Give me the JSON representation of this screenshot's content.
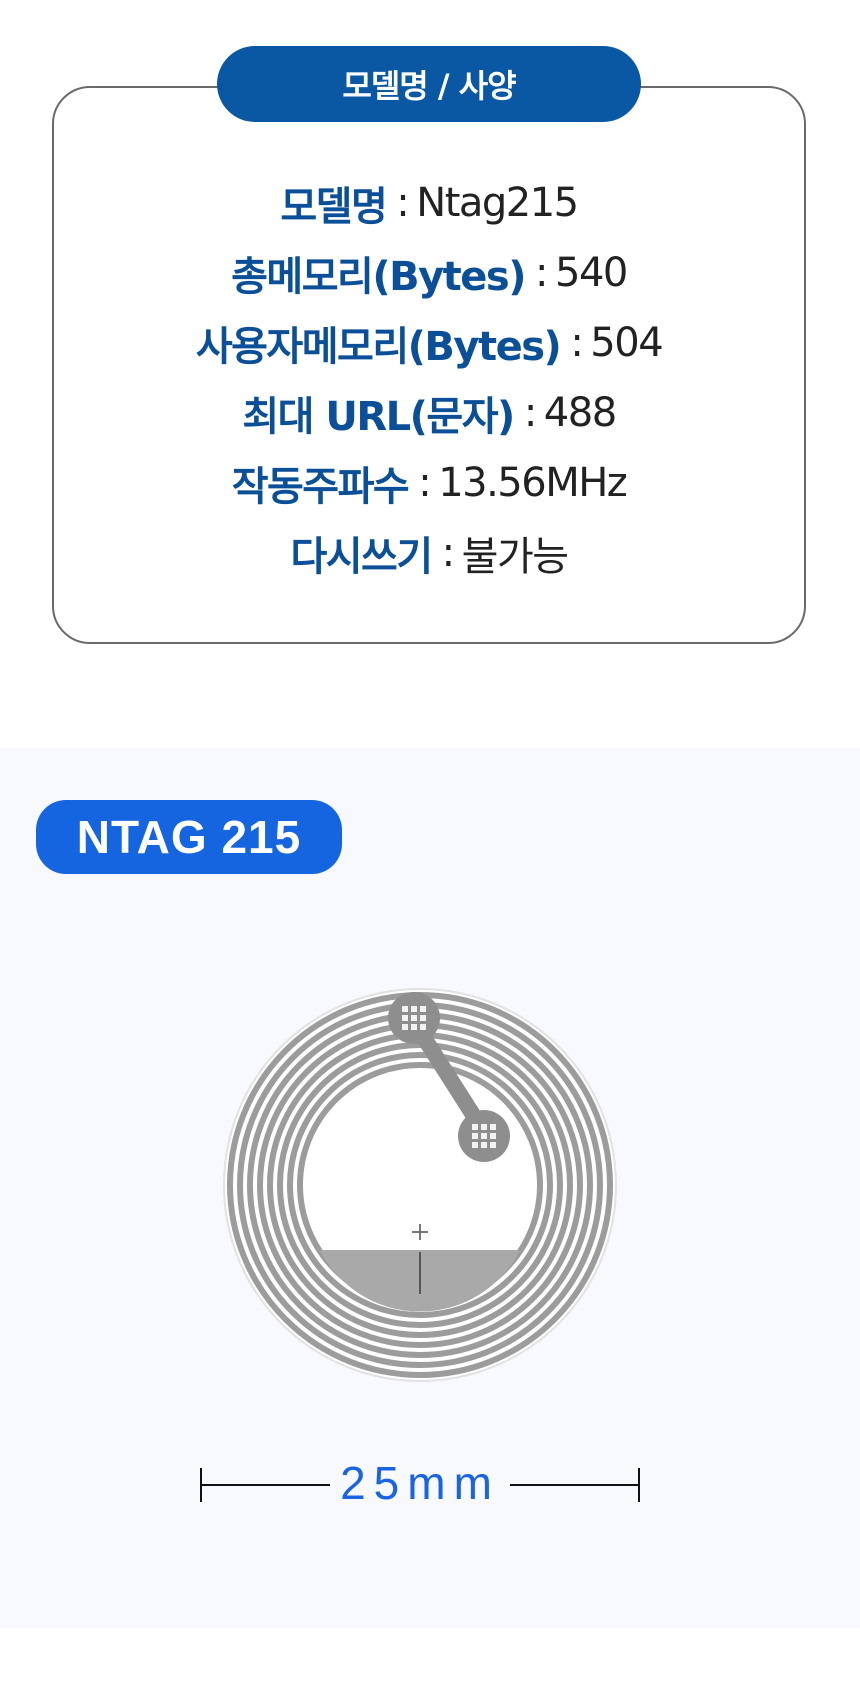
{
  "spec": {
    "title": "모델명 / 사양",
    "rows": [
      {
        "label": "모델명",
        "sep": ":",
        "value": "Ntag215"
      },
      {
        "label": "총메모리(Bytes)",
        "sep": ":",
        "value": "540"
      },
      {
        "label": "사용자메모리(Bytes)",
        "sep": ":",
        "value": "504"
      },
      {
        "label": "최대 URL(문자)",
        "sep": ":",
        "value": "488"
      },
      {
        "label": "작동주파수",
        "sep": ":",
        "value": "13.56MHz"
      },
      {
        "label": "다시쓰기",
        "sep": ":",
        "value": "불가능"
      }
    ]
  },
  "product": {
    "name": "NTAG 215",
    "dimension": "25mm"
  },
  "colors": {
    "spec_accent": "#0a57a4",
    "label_blue": "#0a4f97",
    "name_pill": "#1565e1",
    "dimension_text": "#1a64e4",
    "antenna_gray": "#9a9a9a"
  }
}
